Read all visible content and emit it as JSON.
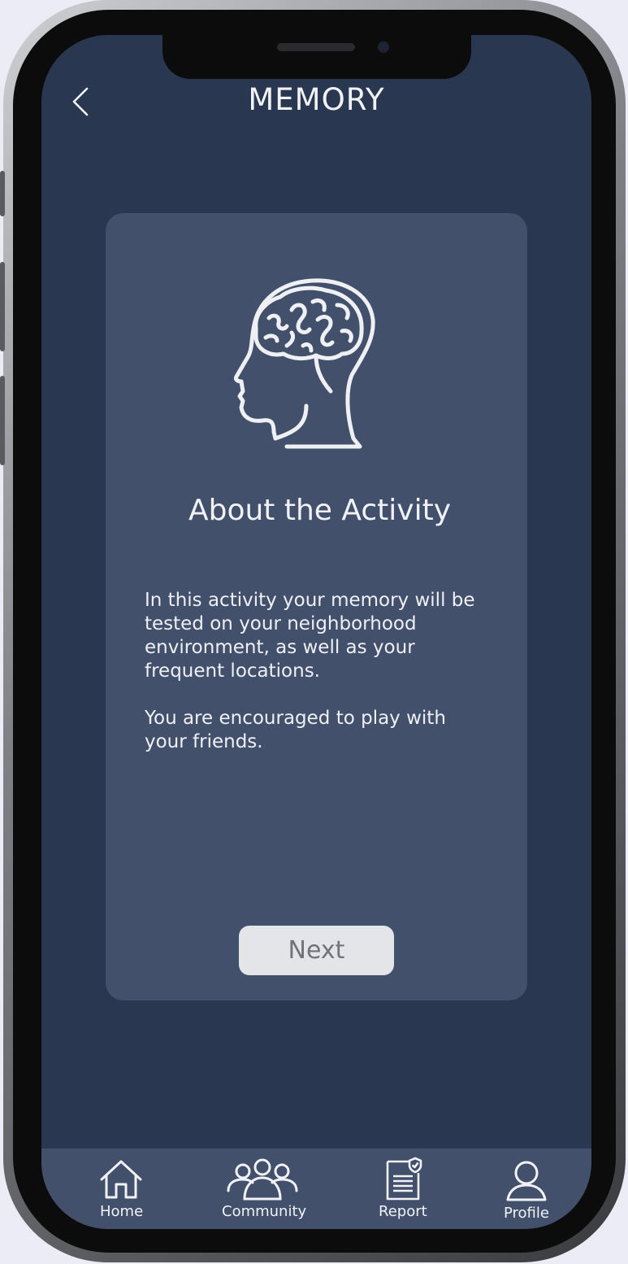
{
  "header": {
    "title": "MEMORY"
  },
  "card": {
    "title": "About the Activity",
    "paragraphs": [
      "In this activity your memory will be tested on your neighborhood environment, as well as your frequent locations.",
      "You are encouraged to play with your friends."
    ],
    "next_label": "Next"
  },
  "nav": {
    "items": [
      {
        "label": "Home",
        "icon": "home-icon"
      },
      {
        "label": "Community",
        "icon": "community-icon"
      },
      {
        "label": "Report",
        "icon": "report-icon"
      },
      {
        "label": "Profile",
        "icon": "profile-icon"
      }
    ]
  },
  "colors": {
    "background": "#2a3750",
    "card": "#42506b",
    "text": "#f1f2f6",
    "button": "#e4e5e8"
  }
}
